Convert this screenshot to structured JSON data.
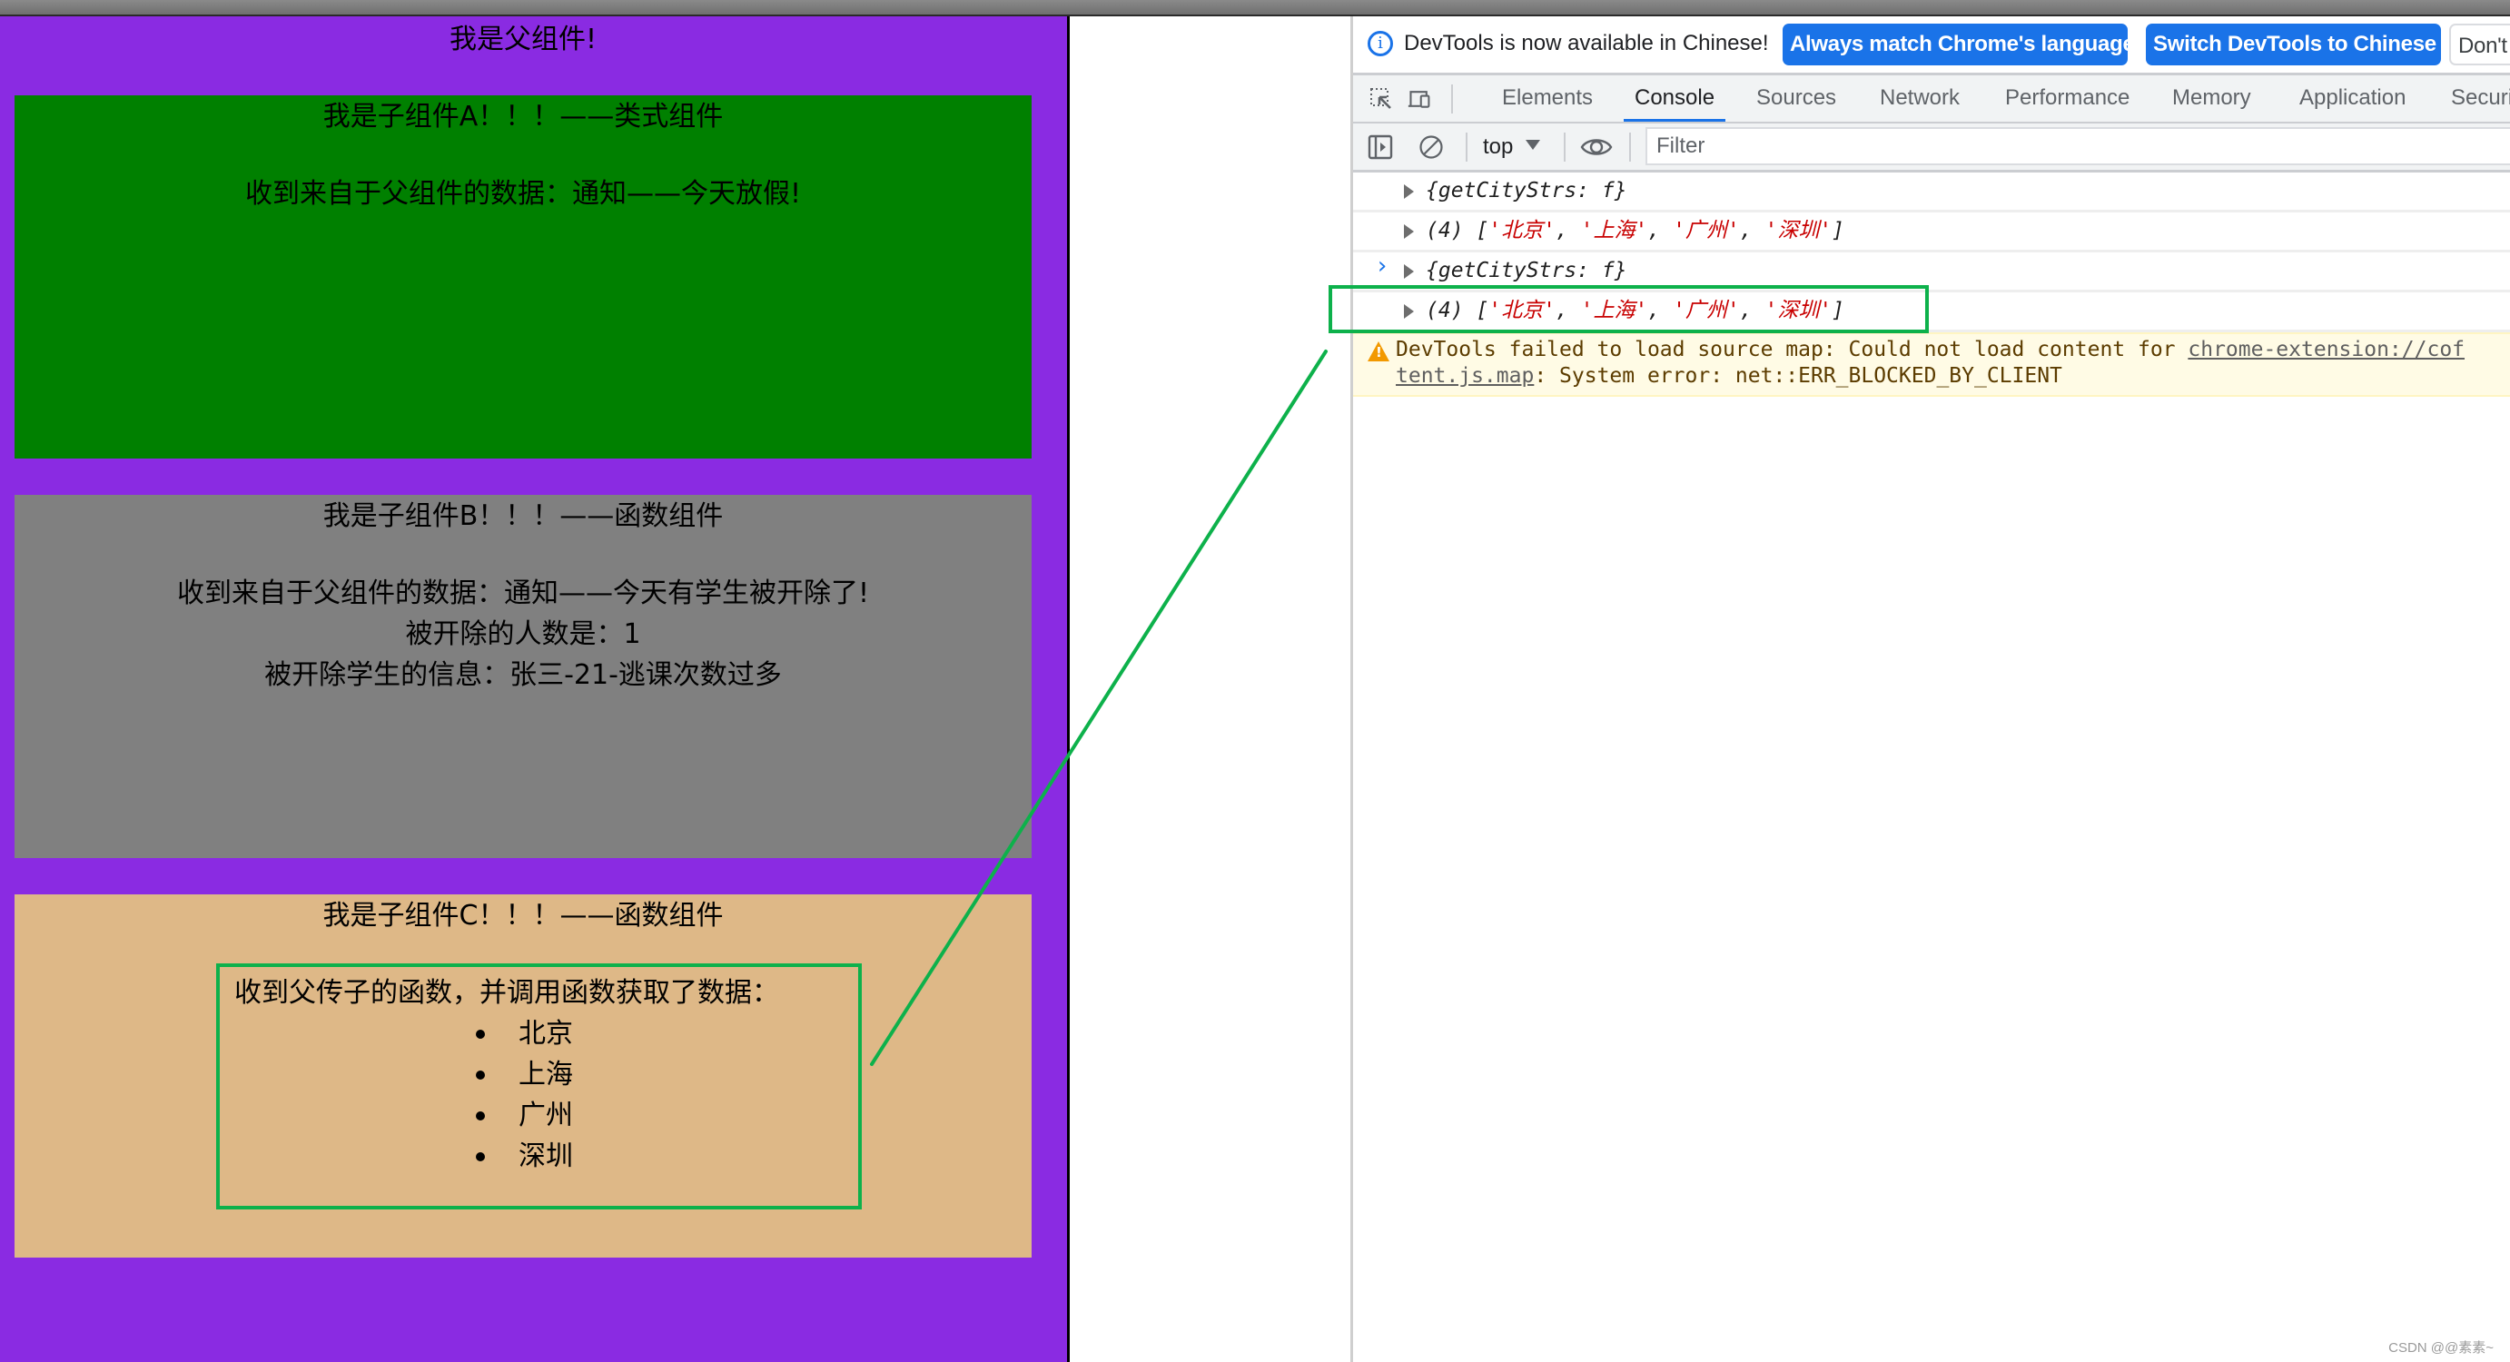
{
  "page": {
    "parent_title": "我是父组件!",
    "colors": {
      "parent_bg": "#8A2BE2",
      "child_a_bg": "#008000",
      "child_b_bg": "#808080",
      "child_c_bg": "#DEB887",
      "annotation": "#0DB14B"
    },
    "child_a": {
      "heading": "我是子组件A！！！——类式组件",
      "lines": [
        "收到来自于父组件的数据：通知——今天放假!"
      ]
    },
    "child_b": {
      "heading": "我是子组件B！！！——函数组件",
      "lines": [
        "收到来自于父组件的数据：通知——今天有学生被开除了!",
        "被开除的人数是：1",
        "被开除学生的信息：张三-21-逃课次数过多"
      ]
    },
    "child_c": {
      "heading": "我是子组件C！！！——函数组件",
      "intro": "收到父传子的函数，并调用函数获取了数据：",
      "cities": [
        "北京",
        "上海",
        "广州",
        "深圳"
      ]
    }
  },
  "devtools": {
    "infobar": {
      "icon": "info-icon",
      "message": "DevTools is now available in Chinese!",
      "buttons": [
        "Always match Chrome's language",
        "Switch DevTools to Chinese",
        "Don't"
      ]
    },
    "tabs": [
      "Elements",
      "Console",
      "Sources",
      "Network",
      "Performance",
      "Memory",
      "Application",
      "Securi"
    ],
    "active_tab": "Console",
    "toolbar": {
      "context": "top",
      "filter_placeholder": "Filter"
    },
    "console": {
      "rows": [
        {
          "type": "object",
          "prefix": "{getCityStrs: ",
          "value": "f",
          "suffix": "}"
        },
        {
          "type": "array",
          "count": "(4) [",
          "items": [
            "'北京'",
            "'上海'",
            "'广州'",
            "'深圳'"
          ],
          "suffix": "]"
        },
        {
          "type": "object",
          "prefix": "{getCityStrs: ",
          "value": "f",
          "suffix": "}"
        },
        {
          "type": "array",
          "count": "(4) [",
          "items": [
            "'北京'",
            "'上海'",
            "'广州'",
            "'深圳'"
          ],
          "suffix": "]"
        }
      ],
      "warning": {
        "line1_text": "DevTools failed to load source map: Could not load content for ",
        "line1_link": "chrome-extension://cof",
        "line2_link": "tent.js.map",
        "line2_text": ": System error: net::ERR_BLOCKED_BY_CLIENT"
      },
      "prompt": "›"
    }
  },
  "watermark": "CSDN @@素素~"
}
